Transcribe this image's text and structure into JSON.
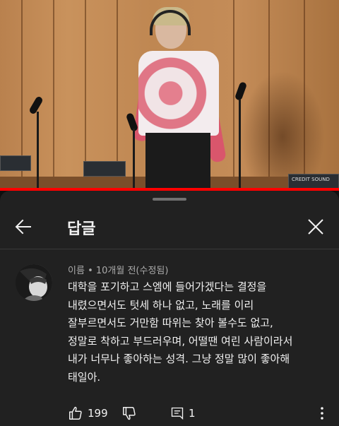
{
  "video": {
    "equipment_label": "CREDIT SOUND",
    "progress": 1.0
  },
  "sheet": {
    "title": "답글",
    "back_icon": "arrow-back-icon",
    "close_icon": "close-icon"
  },
  "comment": {
    "author": "이름",
    "separator": "•",
    "time": "10개월 전(수정됨)",
    "lines": [
      "대학을 포기하고 스엠에 들어가겠다는 결정을",
      "내렸으면서도 텃세 하나 없고, 노래를 이리",
      "잘부르면서도 거만함 따위는 찾아 볼수도 없고,",
      "정말로 착하고 부드러우며, 어떨땐 여린 사람이라서",
      "내가 너무나 좋아하는 성격. 그냥 정말 많이 좋아해",
      "태일아."
    ],
    "likes": "199",
    "replies": "1"
  },
  "colors": {
    "sheet_bg": "#212121",
    "page_bg": "#0f0f0f",
    "text_primary": "#f1f1f1",
    "text_secondary": "#aaaaaa",
    "progress": "#ff0000"
  }
}
